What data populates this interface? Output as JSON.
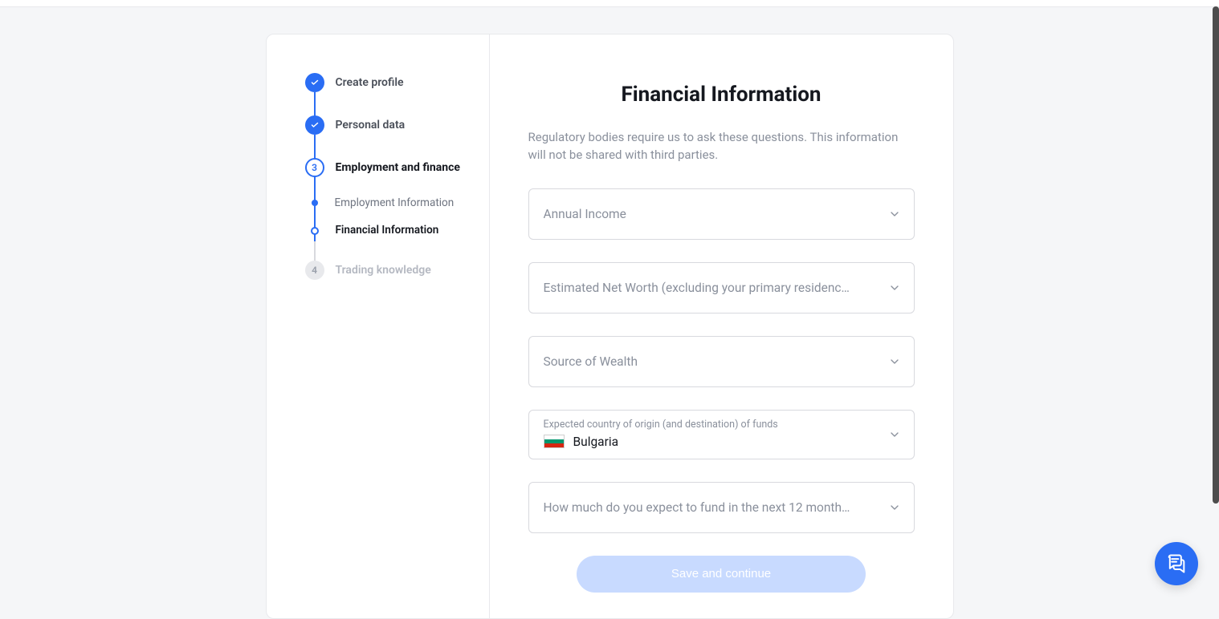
{
  "sidebar": {
    "steps": [
      {
        "label": "Create profile",
        "status": "done"
      },
      {
        "label": "Personal data",
        "status": "done"
      },
      {
        "label": "Employment and finance",
        "status": "current",
        "number": "3",
        "subs": [
          {
            "label": "Employment Information",
            "status": "done"
          },
          {
            "label": "Financial Information",
            "status": "current"
          }
        ]
      },
      {
        "label": "Trading knowledge",
        "status": "future",
        "number": "4"
      }
    ]
  },
  "main": {
    "heading": "Financial Information",
    "subheading": "Regulatory bodies require us to ask these questions. This information will not be shared with third parties.",
    "fields": {
      "annual_income": {
        "placeholder": "Annual Income"
      },
      "net_worth": {
        "placeholder": "Estimated Net Worth (excluding your primary residenc…"
      },
      "source_wealth": {
        "placeholder": "Source of Wealth"
      },
      "country_funds": {
        "label": "Expected country of origin (and destination) of funds",
        "value": "Bulgaria"
      },
      "expected_fund": {
        "placeholder": "How much do you expect to fund in the next 12 month…"
      }
    },
    "cta": "Save and continue"
  }
}
